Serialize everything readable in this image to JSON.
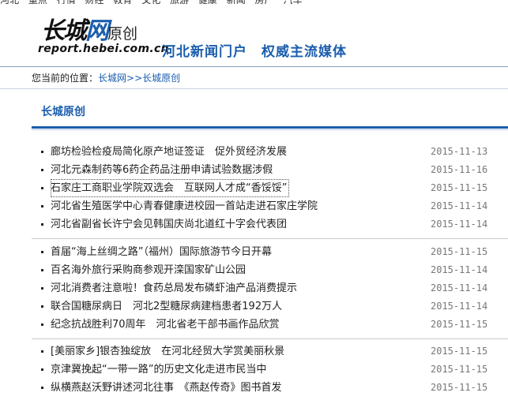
{
  "top_nav": {
    "items": [
      "河北",
      "重点",
      "行情",
      "财经",
      "教育",
      "文化",
      "旅游",
      "健康",
      "新闻",
      "房产",
      "汽车"
    ]
  },
  "header": {
    "logo_main": "长城",
    "logo_accent": "网",
    "logo_small": "原创",
    "logo_url": "report.hebei.com.cn",
    "slogan": "河北新闻门户　权威主流媒体"
  },
  "breadcrumb": {
    "label": "您当前的位置：",
    "path": "长城网>>长城原创"
  },
  "section": {
    "title": "长城原创"
  },
  "news_groups": [
    [
      {
        "title": "廊坊检验检疫局简化原产地证签证　促外贸经济发展",
        "date": "2015-11-13"
      },
      {
        "title": "河北元森制药等6药企药品注册申请试验数据涉假",
        "date": "2015-11-16"
      },
      {
        "title": "石家庄工商职业学院双选会　互联网人才成“香馁馁”",
        "date": "2015-11-15"
      },
      {
        "title": "河北省生殖医学中心青春健康进校园一首站走进石家庄学院",
        "date": "2015-11-14"
      },
      {
        "title": "河北省副省长许宁会见韩国庆尚北道红十字会代表团",
        "date": "2015-11-14"
      }
    ],
    [
      {
        "title": "首届“海上丝绸之路”（福州）国际旅游节今日开幕",
        "date": "2015-11-15"
      },
      {
        "title": "百名海外旅行采购商参观开滦国家矿山公园",
        "date": "2015-11-14"
      },
      {
        "title": "河北消费者注意啦！食药总局发布磷虾油产品消费提示",
        "date": "2015-11-14"
      },
      {
        "title": "联合国糖尿病日　河北2型糖尿病建档患者192万人",
        "date": "2015-11-14"
      },
      {
        "title": "纪念抗战胜利70周年　河北省老干部书画作品欣赏",
        "date": "2015-11-15"
      }
    ],
    [
      {
        "title": "[美丽家乡]银杏独绽放　在河北经贸大学赏美丽秋景",
        "date": "2015-11-15"
      },
      {
        "title": "京津冀挽起“一带一路”的历史文化走进市民当中",
        "date": "2015-11-15"
      },
      {
        "title": "纵横燕赵沃野讲述河北往事　《燕赵传奇》图书首发",
        "date": "2015-11-15"
      }
    ]
  ]
}
